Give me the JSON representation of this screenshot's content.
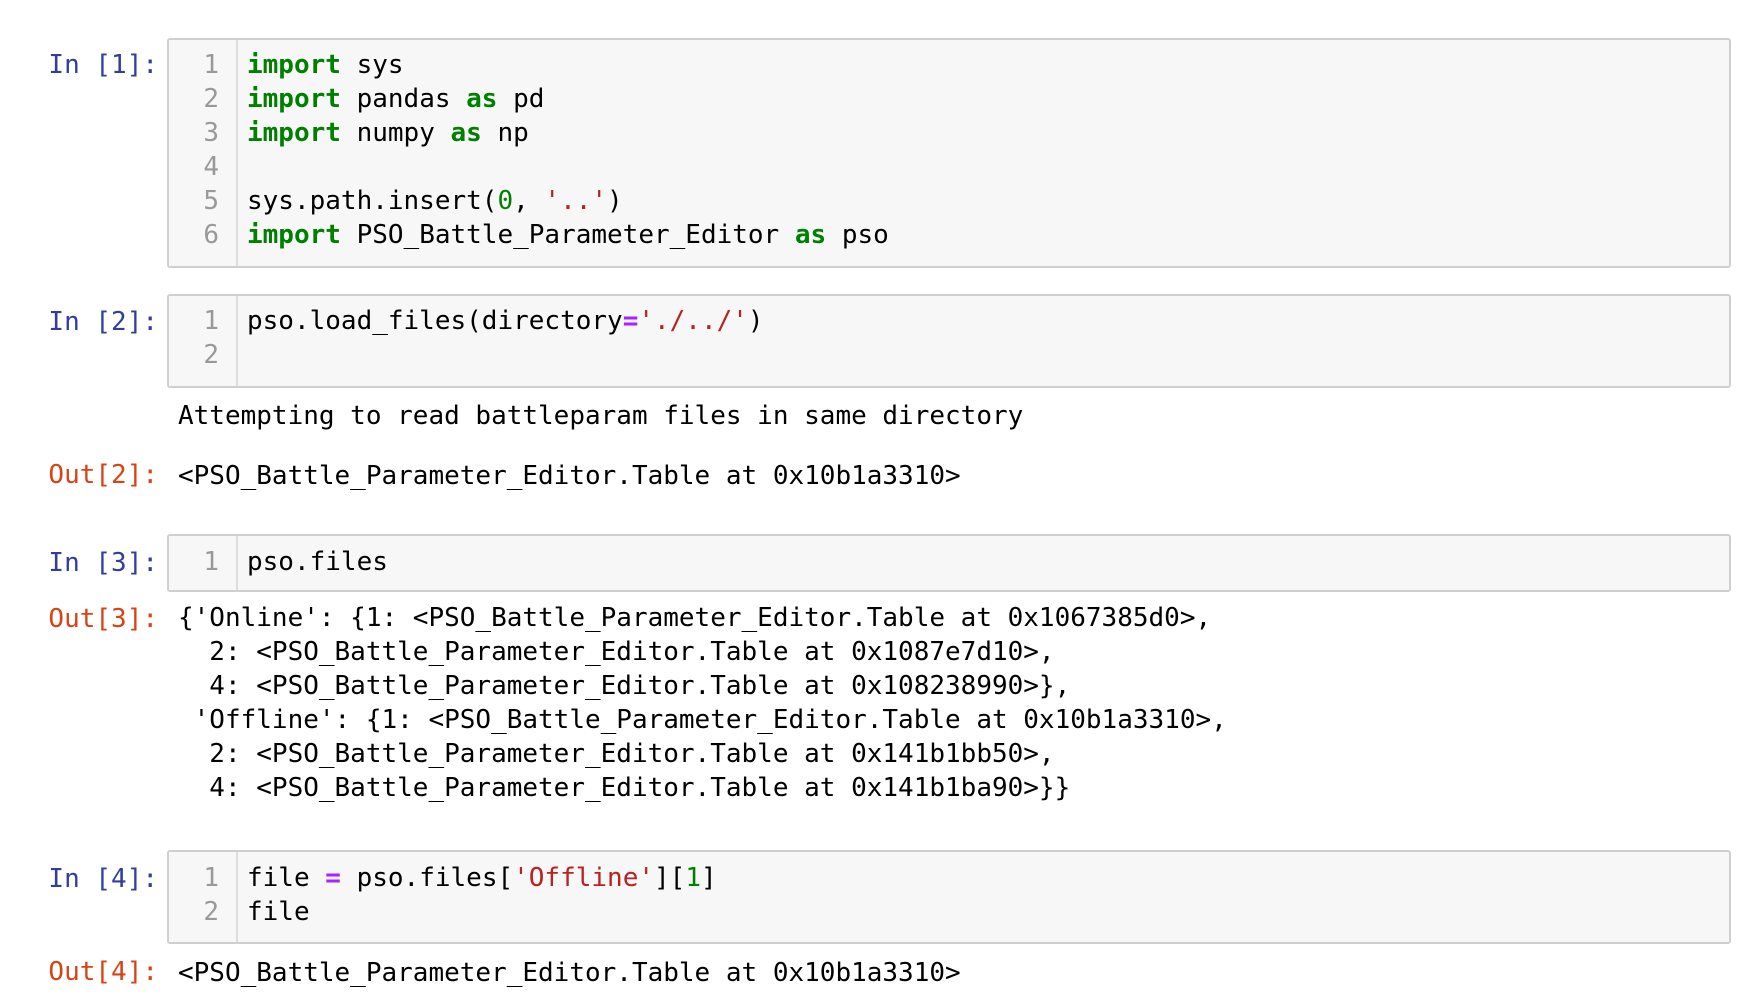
{
  "cells": {
    "c1": {
      "prompt": "In [1]:",
      "lines": [
        {
          "n": "1",
          "parts": [
            [
              "kw",
              "import"
            ],
            [
              "t",
              " sys"
            ]
          ]
        },
        {
          "n": "2",
          "parts": [
            [
              "kw",
              "import"
            ],
            [
              "t",
              " pandas "
            ],
            [
              "kw",
              "as"
            ],
            [
              "t",
              " pd"
            ]
          ]
        },
        {
          "n": "3",
          "parts": [
            [
              "kw",
              "import"
            ],
            [
              "t",
              " numpy "
            ],
            [
              "kw",
              "as"
            ],
            [
              "t",
              " np"
            ]
          ]
        },
        {
          "n": "4",
          "parts": []
        },
        {
          "n": "5",
          "parts": [
            [
              "t",
              "sys.path.insert("
            ],
            [
              "num",
              "0"
            ],
            [
              "t",
              ", "
            ],
            [
              "str",
              "'..'"
            ],
            [
              "t",
              ")"
            ]
          ]
        },
        {
          "n": "6",
          "parts": [
            [
              "kw",
              "import"
            ],
            [
              "t",
              " PSO_Battle_Parameter_Editor "
            ],
            [
              "kw",
              "as"
            ],
            [
              "t",
              " pso"
            ]
          ]
        }
      ]
    },
    "c2": {
      "prompt": "In [2]:",
      "lines": [
        {
          "n": "1",
          "parts": [
            [
              "t",
              "pso.load_files(directory"
            ],
            [
              "op",
              "="
            ],
            [
              "str",
              "'./../'"
            ],
            [
              "t",
              ")"
            ]
          ]
        },
        {
          "n": "2",
          "parts": []
        }
      ],
      "stream": "Attempting to read battleparam files in same directory",
      "out_prompt": "Out[2]:",
      "out_text": "<PSO_Battle_Parameter_Editor.Table at 0x10b1a3310>"
    },
    "c3": {
      "prompt": "In [3]:",
      "lines": [
        {
          "n": "1",
          "parts": [
            [
              "t",
              "pso.files"
            ]
          ]
        }
      ],
      "out_prompt": "Out[3]:",
      "out_lines": [
        "{'Online': {1: <PSO_Battle_Parameter_Editor.Table at 0x1067385d0>,",
        "  2: <PSO_Battle_Parameter_Editor.Table at 0x1087e7d10>,",
        "  4: <PSO_Battle_Parameter_Editor.Table at 0x108238990>},",
        " 'Offline': {1: <PSO_Battle_Parameter_Editor.Table at 0x10b1a3310>,",
        "  2: <PSO_Battle_Parameter_Editor.Table at 0x141b1bb50>,",
        "  4: <PSO_Battle_Parameter_Editor.Table at 0x141b1ba90>}}"
      ]
    },
    "c4": {
      "prompt": "In [4]:",
      "lines": [
        {
          "n": "1",
          "parts": [
            [
              "t",
              "file "
            ],
            [
              "op",
              "="
            ],
            [
              "t",
              " pso.files["
            ],
            [
              "str",
              "'Offline'"
            ],
            [
              "t",
              "]["
            ],
            [
              "num",
              "1"
            ],
            [
              "t",
              "]"
            ]
          ]
        },
        {
          "n": "2",
          "parts": [
            [
              "t",
              "file"
            ]
          ]
        }
      ],
      "out_prompt": "Out[4]:",
      "out_text": "<PSO_Battle_Parameter_Editor.Table at 0x10b1a3310>"
    }
  },
  "colors": {
    "in_prompt": "#303f9f",
    "out_prompt": "#d84315",
    "keyword": "#008000",
    "string": "#ba2121",
    "number": "#008000",
    "operator": "#aa22ff",
    "cell_bg": "#f7f7f7",
    "cell_border": "#cfcfcf"
  }
}
